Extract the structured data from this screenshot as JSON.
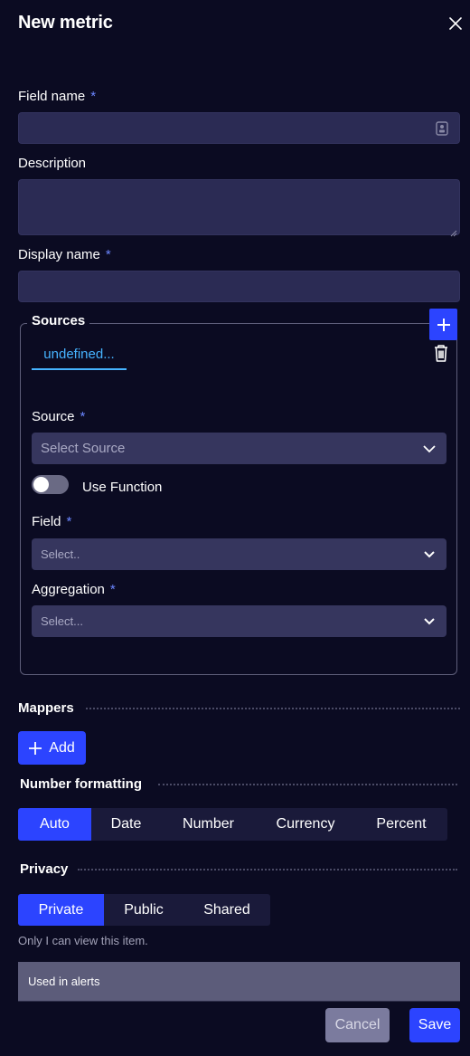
{
  "header": {
    "title": "New metric"
  },
  "fields": {
    "field_name": {
      "label": "Field name",
      "required": "*",
      "value": ""
    },
    "description": {
      "label": "Description",
      "value": ""
    },
    "display_name": {
      "label": "Display name",
      "required": "*",
      "value": ""
    }
  },
  "sources": {
    "title": "Sources",
    "tabs": [
      {
        "label": "undefined..."
      }
    ],
    "source": {
      "label": "Source",
      "required": "*",
      "placeholder": "Select Source"
    },
    "use_function": {
      "label": "Use Function",
      "enabled": false
    },
    "field": {
      "label": "Field",
      "required": "*",
      "placeholder": "Select.."
    },
    "aggregation": {
      "label": "Aggregation",
      "required": "*",
      "placeholder": "Select..."
    }
  },
  "mappers": {
    "title": "Mappers",
    "add_label": "Add"
  },
  "number_formatting": {
    "title": "Number formatting",
    "options": [
      "Auto",
      "Date",
      "Number",
      "Currency",
      "Percent"
    ],
    "selected": "Auto"
  },
  "privacy": {
    "title": "Privacy",
    "options": [
      "Private",
      "Public",
      "Shared"
    ],
    "selected": "Private",
    "hint": "Only I can view this item."
  },
  "alerts": {
    "label": "Used in alerts"
  },
  "footer": {
    "cancel_label": "Cancel",
    "save_label": "Save"
  },
  "colors": {
    "accent": "#2c44ff",
    "background": "#0b0b22",
    "input": "#2b2b54",
    "link": "#46b3ff"
  }
}
